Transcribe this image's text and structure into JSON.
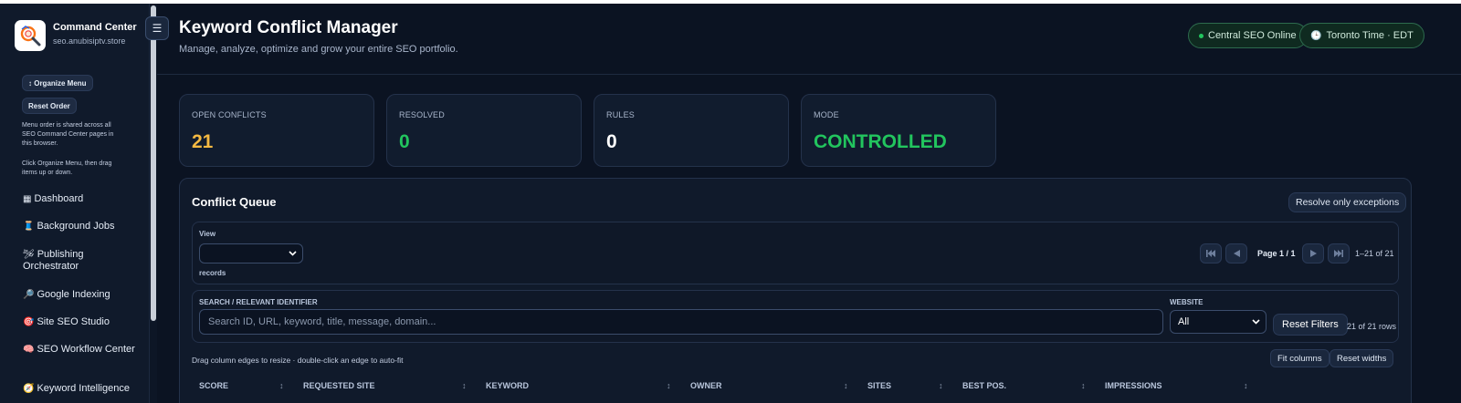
{
  "brand": {
    "title": "Command Center",
    "subtitle": "seo.anubisiptv.store"
  },
  "sidebar": {
    "toggle_icon": "☰",
    "organize_label": "↕ Organize Menu",
    "reset_label": "Reset Order",
    "note1": "Menu order is shared across all SEO Command Center pages in this browser.",
    "note2": "Click Organize Menu, then drag items up or down.",
    "items": [
      {
        "icon": "▦",
        "icon_name": "dashboard-icon",
        "label": "Dashboard"
      },
      {
        "icon": "🧵",
        "icon_name": "thread-icon",
        "label": "Background Jobs"
      },
      {
        "icon": "🛩",
        "icon_name": "plane-icon",
        "label": "Publishing Orchestrator"
      },
      {
        "icon": "🔎",
        "icon_name": "magnifier-icon",
        "label": "Google Indexing"
      },
      {
        "icon": "🎯",
        "icon_name": "target-icon",
        "label": "Site SEO Studio"
      },
      {
        "icon": "🧠",
        "icon_name": "brain-icon",
        "label": "SEO Workflow Center"
      },
      {
        "icon": "🧭",
        "icon_name": "compass-icon",
        "label": "Keyword Intelligence"
      }
    ]
  },
  "header": {
    "title": "Keyword Conflict Manager",
    "subtitle": "Manage, analyze, optimize and grow your entire SEO portfolio.",
    "status_pill": "Central SEO Online",
    "time_icon": "🕒",
    "time_pill": "Toronto Time · EDT"
  },
  "stats": [
    {
      "label": "OPEN CONFLICTS",
      "value": "21",
      "color": "#f5b942"
    },
    {
      "label": "RESOLVED",
      "value": "0",
      "color": "#22c55e"
    },
    {
      "label": "RULES",
      "value": "0",
      "color": "#ffffff"
    },
    {
      "label": "MODE",
      "value": "CONTROLLED",
      "color": "#22c55e"
    }
  ],
  "queue": {
    "title": "Conflict Queue",
    "exceptions_button": "Resolve only exceptions",
    "view_label": "View",
    "view_value": "",
    "records_label": "records",
    "page_text": "Page 1 / 1",
    "range_text": "1–21 of 21",
    "search_label": "SEARCH / RELEVANT IDENTIFIER",
    "search_placeholder": "Search ID, URL, keyword, title, message, domain...",
    "website_label": "WEBSITE",
    "website_value": "All",
    "reset_filters": "Reset Filters",
    "rows_count": "21 of 21 rows",
    "drag_hint": "Drag column edges to resize · double-click an edge to auto-fit",
    "fit_columns": "Fit columns",
    "reset_widths": "Reset widths",
    "sort_icon": "↕",
    "columns": [
      "SCORE",
      "REQUESTED SITE",
      "KEYWORD",
      "OWNER",
      "SITES",
      "BEST POS.",
      "IMPRESSIONS"
    ]
  },
  "colors": {
    "accent_green": "#22c55e",
    "accent_amber": "#f5b942",
    "background": "#0b1322"
  }
}
